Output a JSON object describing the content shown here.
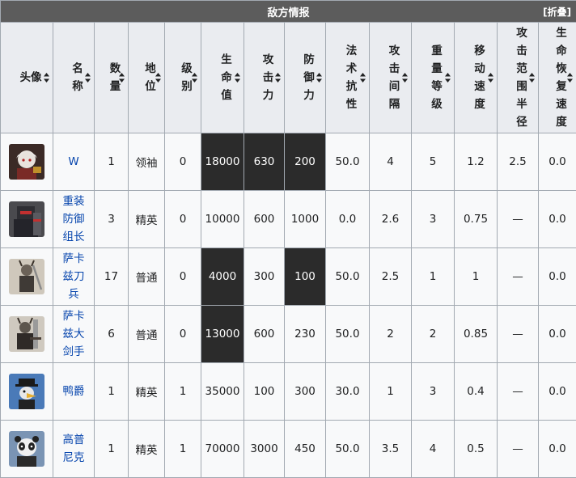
{
  "header": {
    "title": "敌方情报",
    "collapse_label": "[折叠]"
  },
  "columns": [
    {
      "label": "头像"
    },
    {
      "label": "名称"
    },
    {
      "label": "数量"
    },
    {
      "label": "地位"
    },
    {
      "label": "级别"
    },
    {
      "label": "生命值"
    },
    {
      "label": "攻击力"
    },
    {
      "label": "防御力"
    },
    {
      "label": "法术抗性"
    },
    {
      "label": "攻击间隔"
    },
    {
      "label": "重量等级"
    },
    {
      "label": "移动速度"
    },
    {
      "label": "攻击范围半径"
    },
    {
      "label": "生命恢复速度"
    }
  ],
  "rows": [
    {
      "avatar": "w-avatar",
      "name": "W",
      "count": "1",
      "status": "领袖",
      "level": "0",
      "hp": "18000",
      "atk": "630",
      "def": "200",
      "res": "50.0",
      "interval": "4",
      "weight": "5",
      "speed": "1.2",
      "range": "2.5",
      "regen": "0.0"
    },
    {
      "avatar": "heavy-defender-avatar",
      "name": "重装防御组长",
      "count": "3",
      "status": "精英",
      "level": "0",
      "hp": "10000",
      "atk": "600",
      "def": "1000",
      "res": "0.0",
      "interval": "2.6",
      "weight": "3",
      "speed": "0.75",
      "range": "—",
      "regen": "0.0"
    },
    {
      "avatar": "sarkaz-swordsman-avatar",
      "name": "萨卡兹刀兵",
      "count": "17",
      "status": "普通",
      "level": "0",
      "hp": "4000",
      "atk": "300",
      "def": "100",
      "res": "50.0",
      "interval": "2.5",
      "weight": "1",
      "speed": "1",
      "range": "—",
      "regen": "0.0"
    },
    {
      "avatar": "sarkaz-greatswordsman-avatar",
      "name": "萨卡兹大剑手",
      "count": "6",
      "status": "普通",
      "level": "0",
      "hp": "13000",
      "atk": "600",
      "def": "230",
      "res": "50.0",
      "interval": "2",
      "weight": "2",
      "speed": "0.85",
      "range": "—",
      "regen": "0.0"
    },
    {
      "avatar": "duke-avatar",
      "name": "鸭爵",
      "count": "1",
      "status": "精英",
      "level": "1",
      "hp": "35000",
      "atk": "100",
      "def": "300",
      "res": "30.0",
      "interval": "1",
      "weight": "3",
      "speed": "0.4",
      "range": "—",
      "regen": "0.0"
    },
    {
      "avatar": "gopnik-avatar",
      "name": "高普尼克",
      "count": "1",
      "status": "精英",
      "level": "1",
      "hp": "70000",
      "atk": "3000",
      "def": "450",
      "res": "50.0",
      "interval": "3.5",
      "weight": "4",
      "speed": "0.5",
      "range": "—",
      "regen": "0.0"
    }
  ],
  "highlight_color": "#2b2b2b",
  "link_color": "#0645ad",
  "header_bg": "#5c5c5c"
}
